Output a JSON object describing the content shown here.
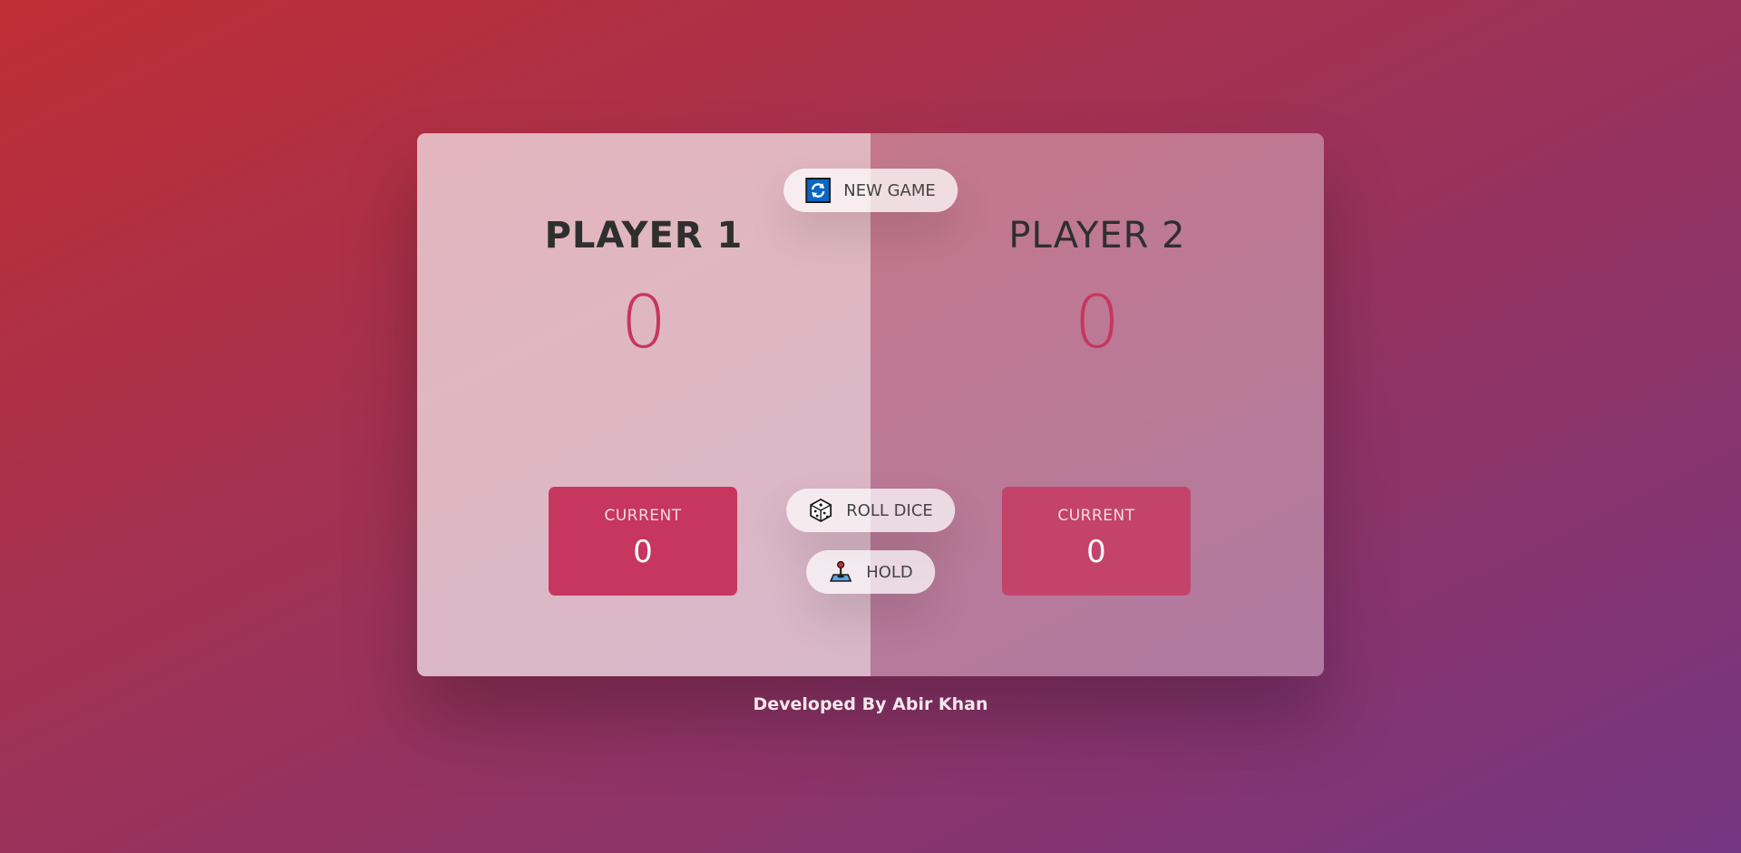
{
  "players": [
    {
      "name": "PLAYER 1",
      "score": "0",
      "current_label": "CURRENT",
      "current": "0"
    },
    {
      "name": "PLAYER 2",
      "score": "0",
      "current_label": "CURRENT",
      "current": "0"
    }
  ],
  "buttons": {
    "new_game": {
      "label": "NEW GAME",
      "icon": "refresh-icon"
    },
    "roll_dice": {
      "label": "ROLL DICE",
      "icon": "dice-icon"
    },
    "hold": {
      "label": "HOLD",
      "icon": "joystick-icon"
    }
  },
  "footer": "Developed By Abir Khan",
  "colors": {
    "accent": "#c7365f",
    "gradient_start": "#bf2e34",
    "gradient_end": "#753682"
  }
}
